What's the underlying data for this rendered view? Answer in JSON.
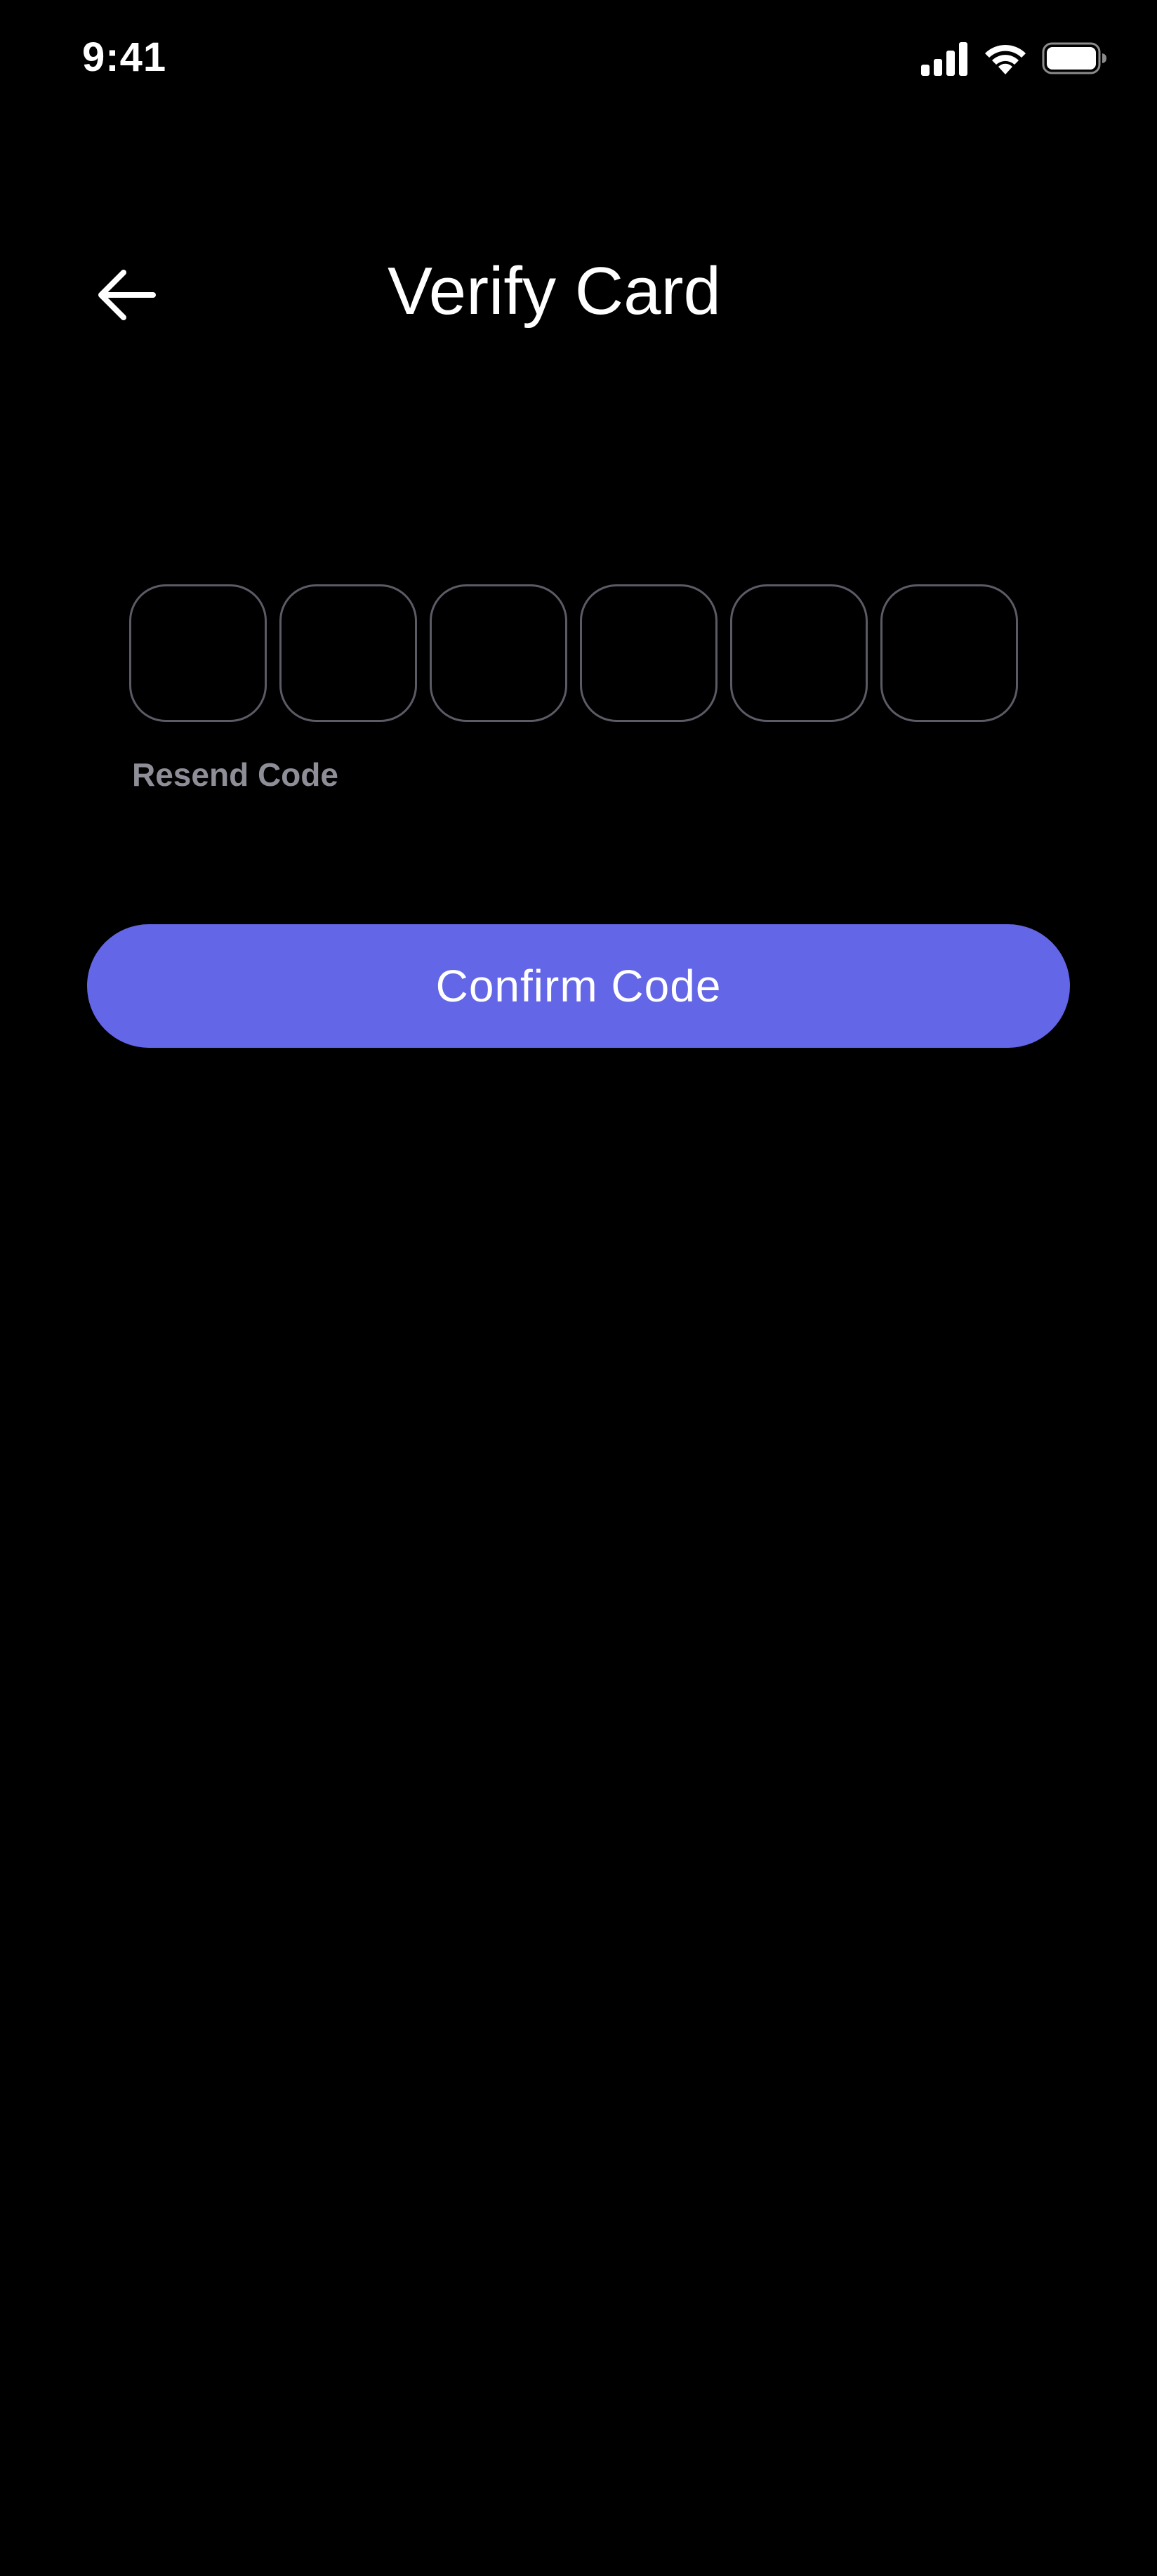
{
  "status_bar": {
    "time": "9:41",
    "icons": [
      "cellular-signal-icon",
      "wifi-icon",
      "battery-icon"
    ]
  },
  "header": {
    "title": "Verify Card",
    "back_icon": "arrow-left-icon"
  },
  "code_input": {
    "digits": [
      "",
      "",
      "",
      "",
      "",
      ""
    ]
  },
  "resend": {
    "label": "Resend Code"
  },
  "confirm": {
    "label": "Confirm Code"
  },
  "colors": {
    "background": "#000000",
    "accent": "#6366e6",
    "box_border": "#5b5b66",
    "muted_text": "#8e8e98",
    "text": "#ffffff"
  }
}
